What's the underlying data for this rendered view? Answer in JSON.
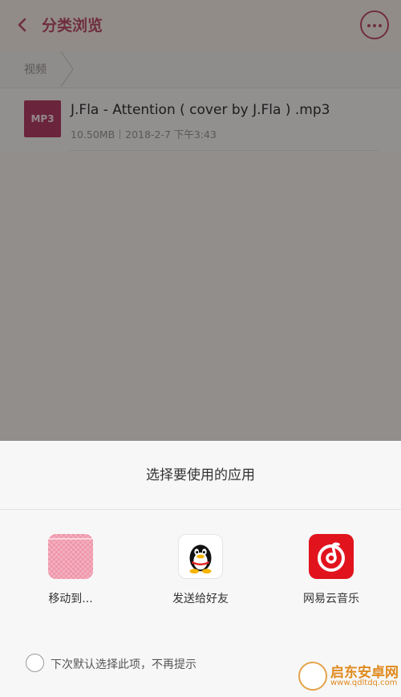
{
  "header": {
    "title": "分类浏览",
    "back_icon": "chevron-left-icon",
    "more_icon": "more-dots-icon"
  },
  "breadcrumb": {
    "item": "视频"
  },
  "file": {
    "type_badge": "MP3",
    "name": "J.Fla - Attention ( cover by J.Fla ) .mp3",
    "size": "10.50MB",
    "date": "2018-2-7 下午3:43"
  },
  "chooser": {
    "title": "选择要使用的应用",
    "apps": [
      {
        "label": "移动到...",
        "icon": "folder-icon"
      },
      {
        "label": "发送给好友",
        "icon": "qq-penguin-icon"
      },
      {
        "label": "网易云音乐",
        "icon": "netease-music-icon"
      }
    ],
    "remember_text": "下次默认选择此项，不再提示",
    "remember_checked": false
  },
  "watermark": {
    "brand": "启东安卓网",
    "url": "www.qdltdq.com"
  },
  "colors": {
    "accent": "#c0506c",
    "mp3_badge": "#b73f66",
    "netease_red": "#e1131d"
  }
}
